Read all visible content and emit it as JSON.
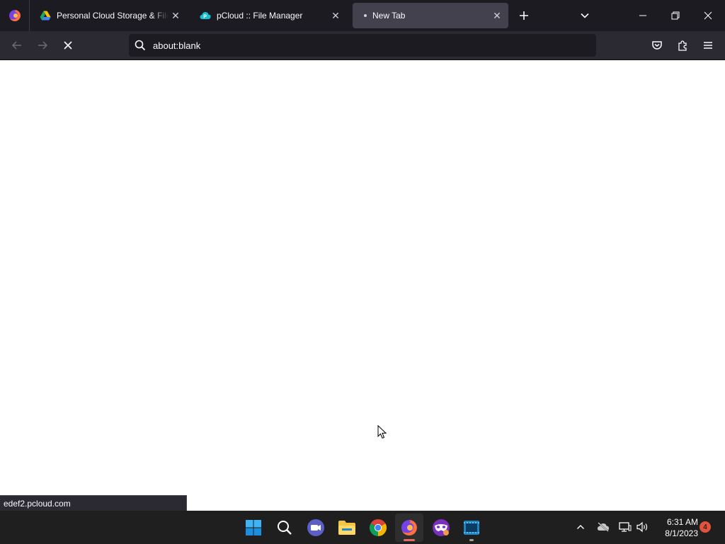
{
  "browser": {
    "tabs": [
      {
        "title": "Personal Cloud Storage & File S",
        "icon": "google-drive-icon",
        "active": false
      },
      {
        "title": "pCloud :: File Manager",
        "icon": "pcloud-icon",
        "active": false
      },
      {
        "title": "New Tab",
        "icon": "loading-dot-icon",
        "active": true
      }
    ],
    "address": "about:blank",
    "status_url": "edef2.pcloud.com"
  },
  "taskbar": {
    "apps": [
      "windows-start-icon",
      "search-icon",
      "teams-meet-icon",
      "file-explorer-icon",
      "chrome-icon",
      "firefox-icon",
      "mask-app-icon",
      "video-editor-icon"
    ],
    "time": "6:31 AM",
    "date": "8/1/2023",
    "notification_count": "4"
  },
  "colors": {
    "tabstrip_bg": "#1c1b22",
    "navbar_bg": "#2b2a33",
    "active_tab_bg": "#42414d",
    "taskbar_bg": "#1f1f1f",
    "notification_badge": "#e0533f"
  }
}
